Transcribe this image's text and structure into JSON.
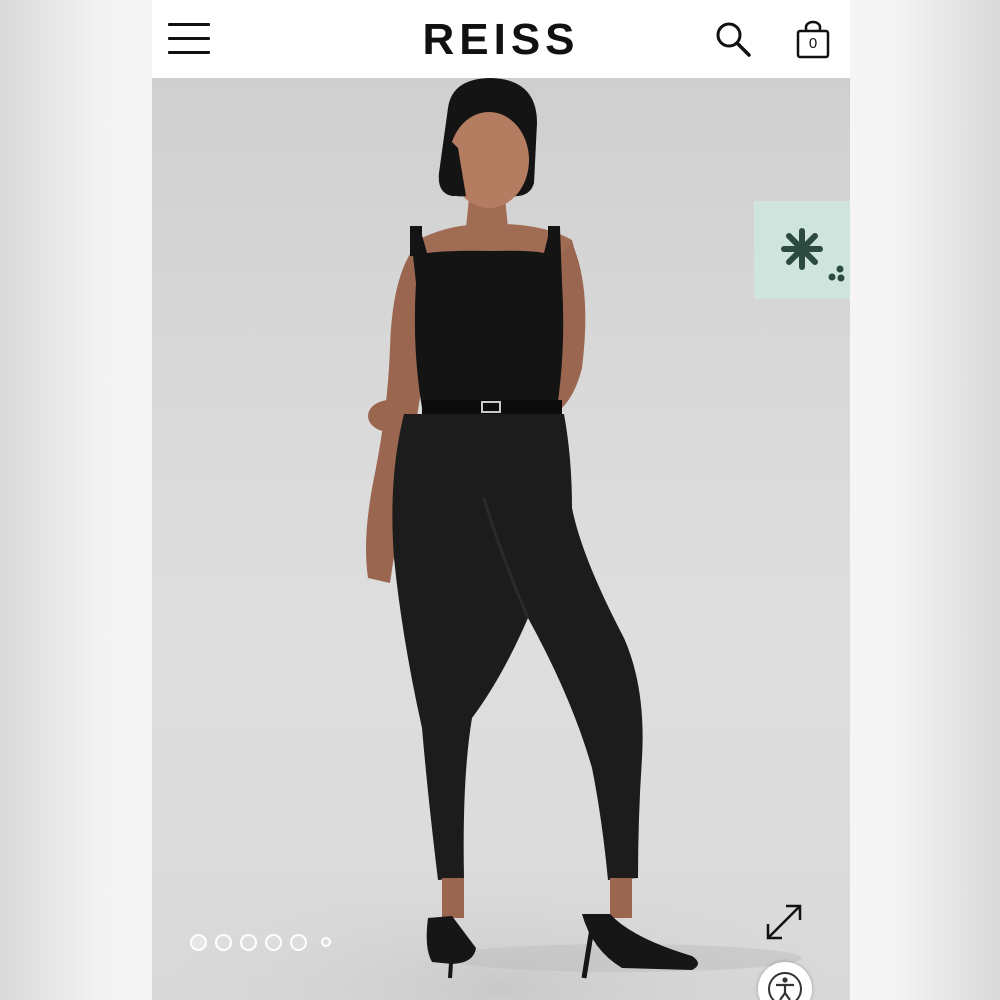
{
  "header": {
    "logo": "REISS",
    "bag_count": "0"
  },
  "icons": {
    "menu": "hamburger-menu-icon",
    "search": "search-icon",
    "bag": "shopping-bag-icon",
    "badge": "asterisk-icon",
    "expand": "expand-arrows-icon",
    "accessibility": "accessibility-icon"
  },
  "carousel": {
    "total_dots": 6,
    "active_index": 0
  },
  "colors": {
    "badge_background": "#cfe4dd",
    "badge_icon": "#2d4a40",
    "brand_text": "#111111"
  }
}
